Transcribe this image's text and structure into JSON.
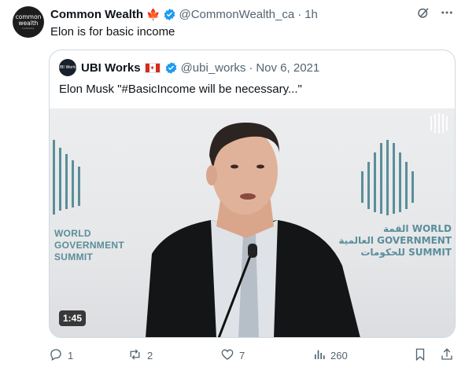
{
  "account": {
    "avatar_line1": "common",
    "avatar_line2": "wealth",
    "avatar_line3": "CANADA",
    "name": "Common Wealth",
    "flag_icon": "maple-leaf",
    "handle": "@CommonWealth_ca",
    "separator": "·",
    "time": "1h"
  },
  "tweet": {
    "text": "Elon is for basic income"
  },
  "quote": {
    "avatar_text": "UBI Works",
    "name": "UBI Works",
    "handle": "@ubi_works",
    "separator": "·",
    "date": "Nov 6, 2021",
    "text": "Elon Musk \"#BasicIncome will be necessary...\"",
    "video": {
      "summit_left_lines": [
        "WORLD",
        "GOVERNMENT",
        "SUMMIT"
      ],
      "summit_right_lines": [
        "القمة WORLD",
        "العالمية GOVERNMENT",
        "للحكومات SUMMIT"
      ],
      "duration": "1:45"
    }
  },
  "actions": {
    "reply_count": "1",
    "retweet_count": "2",
    "like_count": "7",
    "views_count": "260"
  },
  "colors": {
    "accent": "#1d9bf0",
    "secondary_text": "#536471",
    "summit_teal": "#5a8e9a"
  }
}
